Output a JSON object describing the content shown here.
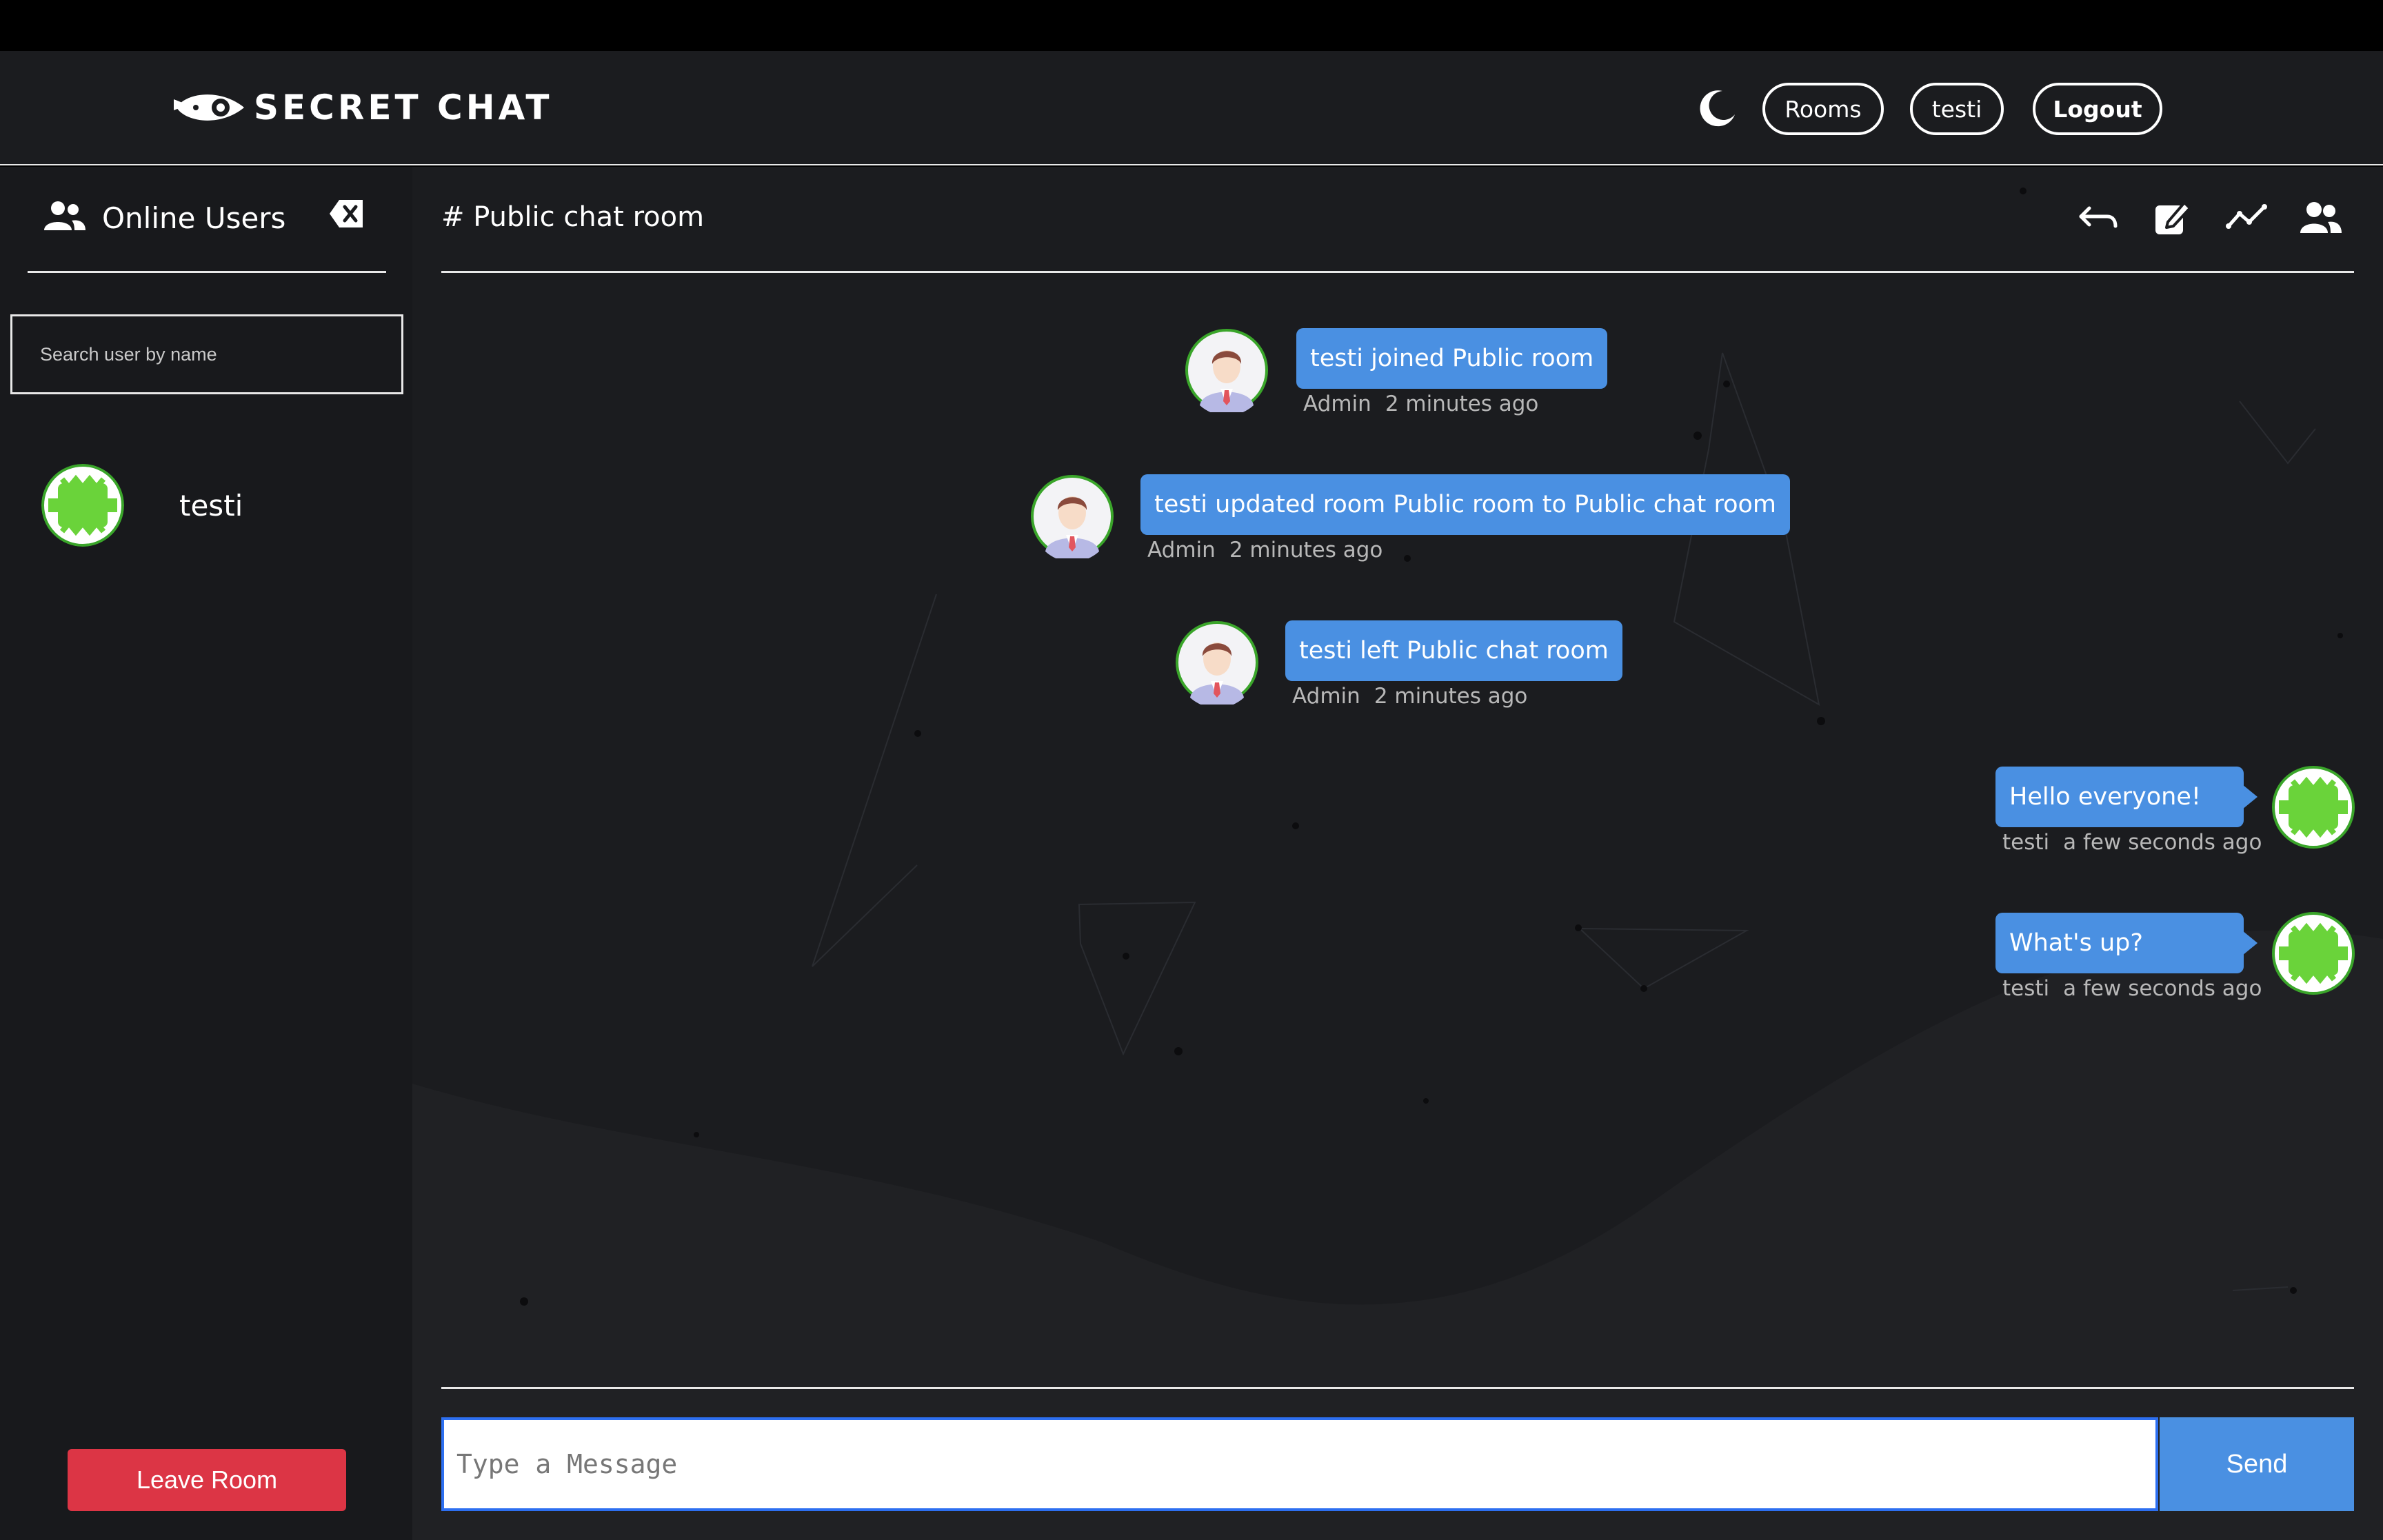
{
  "brand": {
    "name": "SECRET CHAT"
  },
  "nav": {
    "rooms_label": "Rooms",
    "user_label": "testi",
    "logout_label": "Logout"
  },
  "sidebar": {
    "title": "Online Users",
    "search_placeholder": "Search user by name",
    "users": [
      {
        "name": "testi"
      }
    ],
    "leave_label": "Leave Room"
  },
  "room": {
    "title": "# Public chat room"
  },
  "messages": [
    {
      "text": "testi joined Public room",
      "author": "Admin",
      "time": "2 minutes ago",
      "side": "center"
    },
    {
      "text": "testi updated room Public room to Public chat room",
      "author": "Admin",
      "time": "2 minutes ago",
      "side": "center"
    },
    {
      "text": "testi left Public chat room",
      "author": "Admin",
      "time": "2 minutes ago",
      "side": "center"
    },
    {
      "text": "Hello everyone!",
      "author": "testi",
      "time": "a few seconds ago",
      "side": "right"
    },
    {
      "text": "What's up?",
      "author": "testi",
      "time": "a few seconds ago",
      "side": "right"
    }
  ],
  "composer": {
    "placeholder": "Type a Message",
    "send_label": "Send"
  },
  "colors": {
    "accent": "#4a90e2",
    "danger": "#dc3545",
    "avatar_green": "#6ad33a",
    "background": "#1b1c1f",
    "input_focus": "#2d6ff0"
  },
  "icons": [
    "logo-icon",
    "moon-icon",
    "users-icon",
    "backspace-icon",
    "reply-icon",
    "edit-icon",
    "chart-icon",
    "group-icon",
    "admin-avatar-icon",
    "green-avatar-icon"
  ]
}
